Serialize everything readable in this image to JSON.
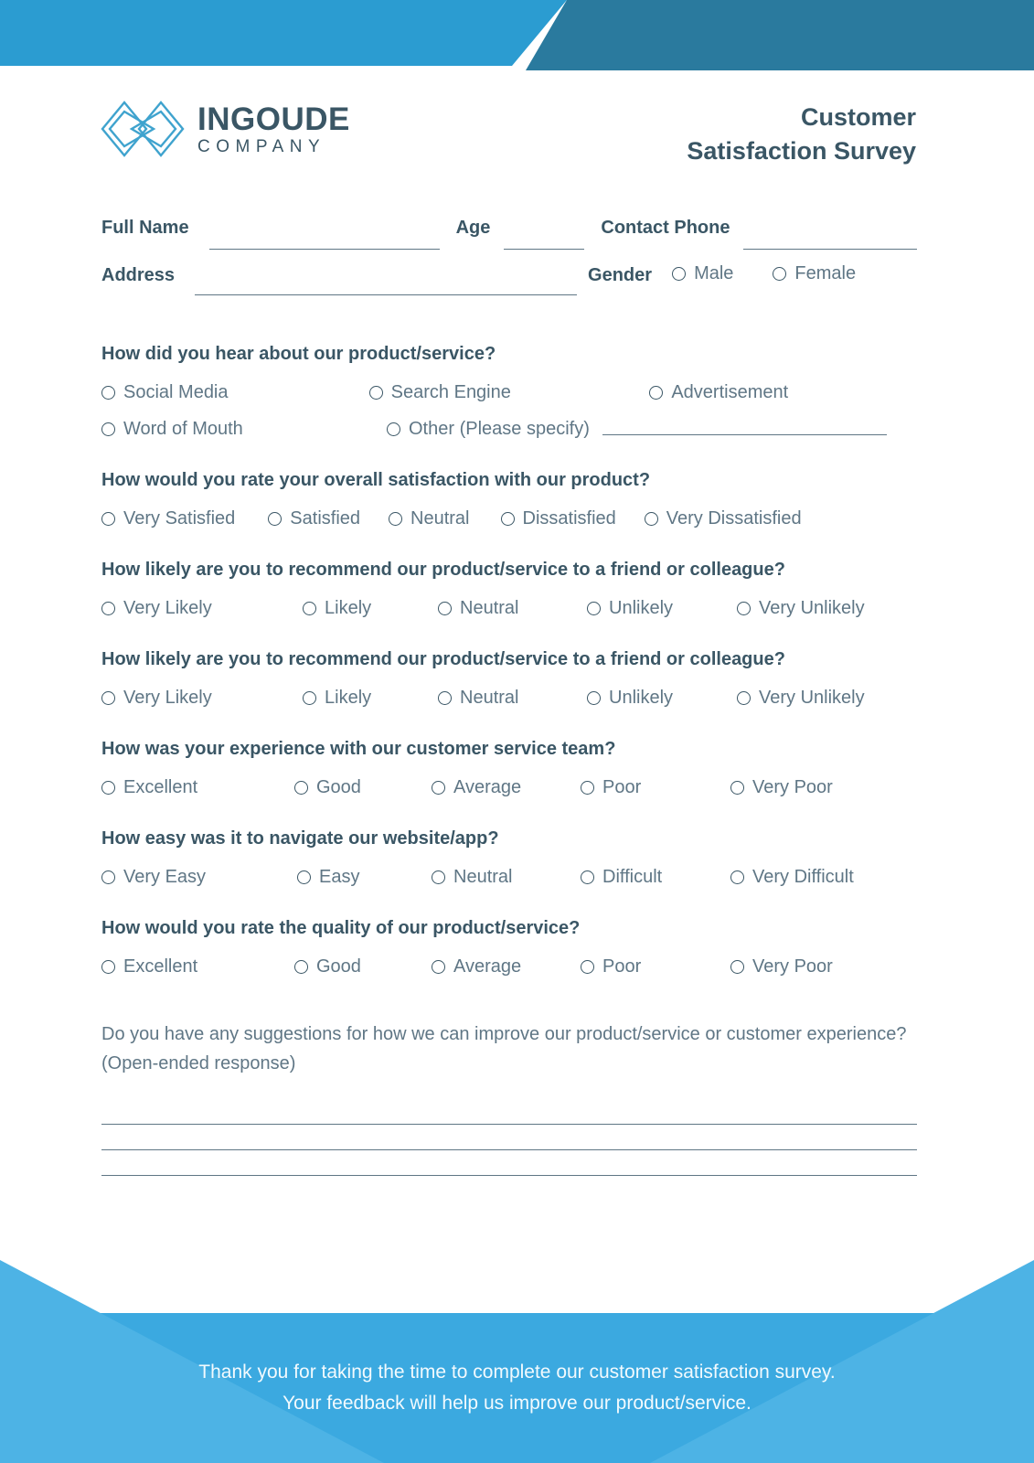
{
  "brand": {
    "logo_icon": "double-diamond-logo-icon",
    "name": "INGOUDE",
    "subtitle": "COMPANY"
  },
  "header": {
    "title_line1": "Customer",
    "title_line2": "Satisfaction Survey",
    "band_light_color": "#2B9CD1",
    "band_dark_color": "#2A7A9E"
  },
  "identity": {
    "full_name_label": "Full Name",
    "full_name_value": "",
    "age_label": "Age",
    "age_value": "",
    "contact_phone_label": "Contact Phone",
    "contact_phone_value": "",
    "address_label": "Address",
    "address_value": "",
    "gender_label": "Gender",
    "gender_options": [
      "Male",
      "Female"
    ]
  },
  "questions": [
    {
      "title": "How did you hear about our product/service?",
      "layout": "grid3",
      "options": [
        "Social Media",
        "Search Engine",
        "Advertisement",
        "Word of Mouth",
        "Other (Please specify)"
      ],
      "other_value": ""
    },
    {
      "title": "How would you rate your overall satisfaction with our product?",
      "layout": "scale",
      "options": [
        "Very Satisfied",
        "Satisfied",
        "Neutral",
        "Dissatisfied",
        "Very Dissatisfied"
      ]
    },
    {
      "title": "How likely are you to recommend our product/service to a friend or colleague?",
      "layout": "scale",
      "options": [
        "Very Likely",
        "Likely",
        "Neutral",
        "Unlikely",
        "Very Unlikely"
      ]
    },
    {
      "title": "How likely are you to recommend our product/service to a friend or colleague?",
      "layout": "scale",
      "options": [
        "Very Likely",
        "Likely",
        "Neutral",
        "Unlikely",
        "Very Unlikely"
      ]
    },
    {
      "title": "How was your experience with our customer service team?",
      "layout": "scale",
      "options": [
        "Excellent",
        "Good",
        "Average",
        "Poor",
        "Very Poor"
      ]
    },
    {
      "title": "How easy was it to navigate our website/app?",
      "layout": "scale",
      "options": [
        "Very Easy",
        "Easy",
        "Neutral",
        "Difficult",
        "Very Difficult"
      ]
    },
    {
      "title": "How would you rate the quality of our product/service?",
      "layout": "scale",
      "options": [
        "Excellent",
        "Good",
        "Average",
        "Poor",
        "Very Poor"
      ]
    }
  ],
  "open_ended": {
    "prompt": "Do you have any suggestions for how we can improve our product/service or customer experience? (Open-ended response)",
    "line_count": 3,
    "line_values": [
      "",
      "",
      ""
    ]
  },
  "footer": {
    "line1": "Thank you for taking the time to complete our customer satisfaction survey.",
    "line2": "Your feedback will help us improve our product/service.",
    "base_color": "#3BA9E0",
    "wedge_color": "#4DB3E5"
  }
}
